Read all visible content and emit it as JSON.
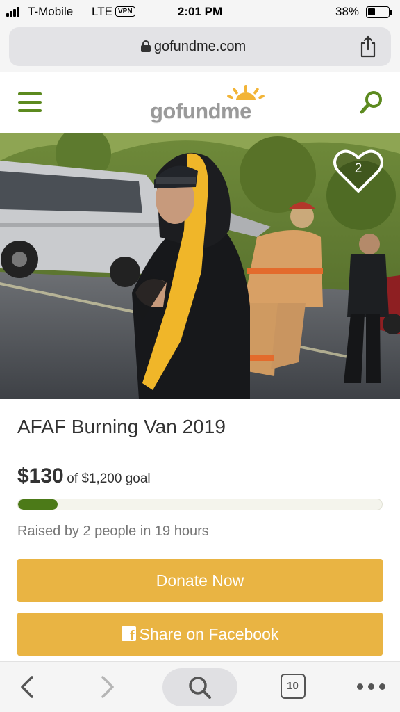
{
  "status_bar": {
    "carrier": "T-Mobile",
    "network": "LTE",
    "vpn": "VPN",
    "time": "2:01 PM",
    "battery_pct": "38%",
    "battery_level": 0.38
  },
  "browser": {
    "url": "gofundme.com",
    "icons": {
      "lock": "lock-icon",
      "share": "share-icon"
    }
  },
  "header": {
    "logo_text": "gofundme",
    "icons": {
      "menu": "hamburger-menu-icon",
      "search": "search-icon"
    },
    "brand_color": "#5c8a1f"
  },
  "campaign": {
    "image_description_icon": "campaign-photo",
    "hearts": "2",
    "title": "AFAF Burning Van 2019",
    "raised": "$130",
    "goal_text": "of $1,200 goal",
    "progress_fraction": 0.108,
    "meta": "Raised by 2 people in 19 hours"
  },
  "actions": {
    "donate_label": "Donate Now",
    "share_label": "Share on Facebook",
    "button_color": "#e9b443"
  },
  "toolbar": {
    "tabs_count": "10",
    "icons": {
      "back": "chevron-left-icon",
      "forward": "chevron-right-icon",
      "search": "search-icon",
      "tabs": "tabs-icon",
      "more": "more-dots-icon"
    }
  }
}
